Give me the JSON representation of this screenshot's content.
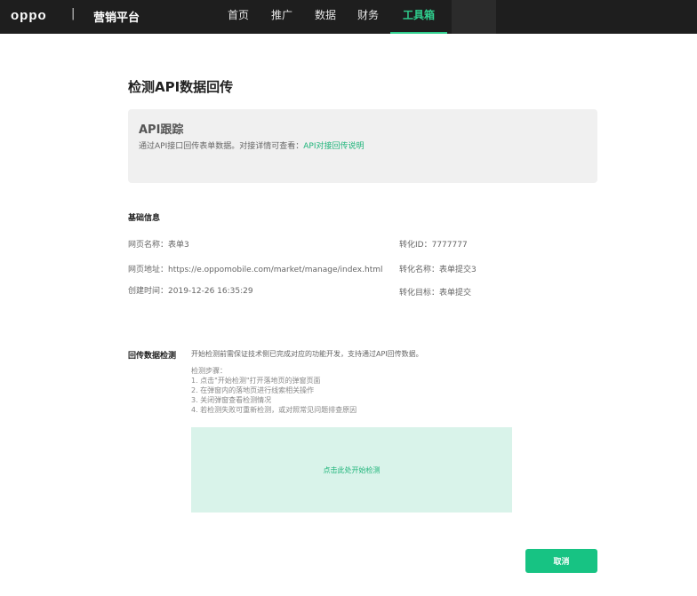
{
  "header": {
    "logo": "oppo",
    "separator": "|",
    "platform": "营销平台",
    "nav": [
      "首页",
      "推广",
      "数据",
      "财务",
      "工具箱"
    ],
    "active_nav": "工具箱"
  },
  "page": {
    "title": "检测API数据回传"
  },
  "info_box": {
    "title": "API跟踪",
    "desc_prefix": "通过API接口回传表单数据。对接详情可查看：",
    "link": "API对接回传说明"
  },
  "basic_info": {
    "title": "基础信息",
    "page_name_label": "网页名称：",
    "page_name_value": "表单3",
    "page_url_label": "网页地址：",
    "page_url_value": "https://e.oppomobile.com/market/manage/index.html",
    "created_label": "创建时间：",
    "created_value": "2019-12-26 16:35:29",
    "conv_id_label": "转化ID：",
    "conv_id_value": "7777777",
    "conv_name_label": "转化名称：",
    "conv_name_value": "表单提交3",
    "conv_goal_label": "转化目标：",
    "conv_goal_value": "表单提交"
  },
  "check": {
    "label": "回传数据检测",
    "desc": "开始检测前需保证技术侧已完成对应的功能开发，支持通过API回传数据。",
    "steps_title": "检测步骤：",
    "steps": [
      "1. 点击\"开始检测\"打开落地页的弹窗页面",
      "2. 在弹窗内的落地页进行线索相关操作",
      "3. 关闭弹窗查看检测情况",
      "4. 若检测失败可重新检测，或对照常见问题排查原因"
    ],
    "start_text": "点击此处开始检测"
  },
  "footer": {
    "cancel": "取消"
  }
}
